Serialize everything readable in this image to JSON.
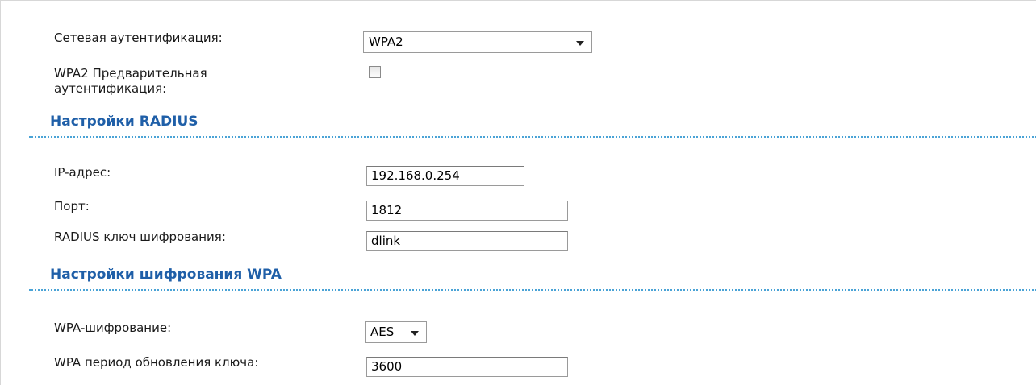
{
  "auth": {
    "network_auth_label": "Сетевая аутентификация:",
    "network_auth_value": "WPA2",
    "preauth_label_line1": "WPA2 Предварительная",
    "preauth_label_line2": "аутентификация:",
    "preauth_checked": false
  },
  "radius": {
    "section_title": "Настройки RADIUS",
    "ip_label": "IP-адрес:",
    "ip_value": "192.168.0.254",
    "port_label": "Порт:",
    "port_value": "1812",
    "key_label": "RADIUS ключ шифрования:",
    "key_value": "dlink"
  },
  "wpa": {
    "section_title": "Настройки шифрования WPA",
    "encryption_label": "WPA-шифрование:",
    "encryption_value": "AES",
    "rekey_label": "WPA период обновления ключа:",
    "rekey_value": "3600"
  },
  "colors": {
    "section_title": "#1f5fa8",
    "divider": "#4aa3d6"
  }
}
